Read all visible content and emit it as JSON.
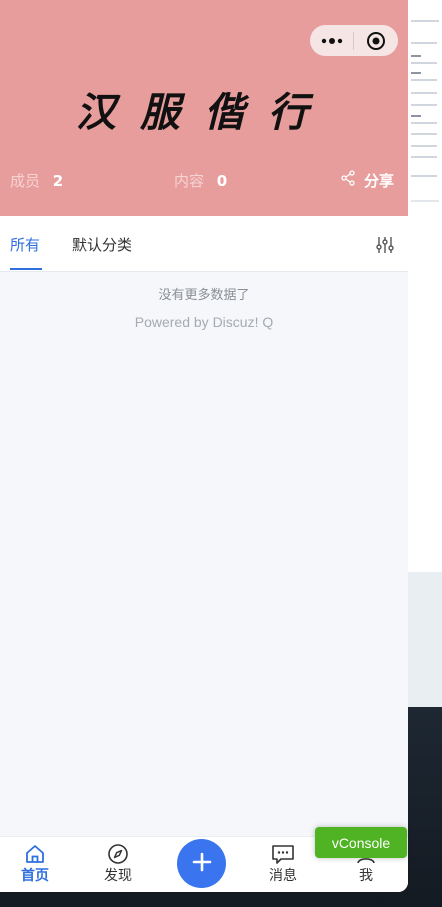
{
  "header": {
    "title": "汉服偕行",
    "bg_color": "#e89d9d",
    "stats": {
      "members_label": "成员",
      "members_value": "2",
      "content_label": "内容",
      "content_value": "0",
      "share_label": "分享"
    },
    "capsule": {
      "more_icon": "more-dots-icon",
      "close_icon": "target-close-icon"
    }
  },
  "tabs": [
    {
      "label": "所有",
      "active": true
    },
    {
      "label": "默认分类",
      "active": false
    }
  ],
  "feed": {
    "empty_text": "没有更多数据了",
    "powered_text": "Powered by Discuz! Q"
  },
  "tabbar": {
    "items": [
      {
        "label": "首页",
        "icon": "home-icon",
        "active": true
      },
      {
        "label": "发现",
        "icon": "compass-icon",
        "active": false
      },
      {
        "label": "消息",
        "icon": "message-icon",
        "active": false
      },
      {
        "label": "我",
        "icon": "user-icon",
        "active": false
      }
    ],
    "post_icon": "plus-icon"
  },
  "vconsole": {
    "label": "vConsole"
  },
  "colors": {
    "accent": "#2f6fe0",
    "post_button": "#3a74ee",
    "vconsole": "#4fb323"
  }
}
